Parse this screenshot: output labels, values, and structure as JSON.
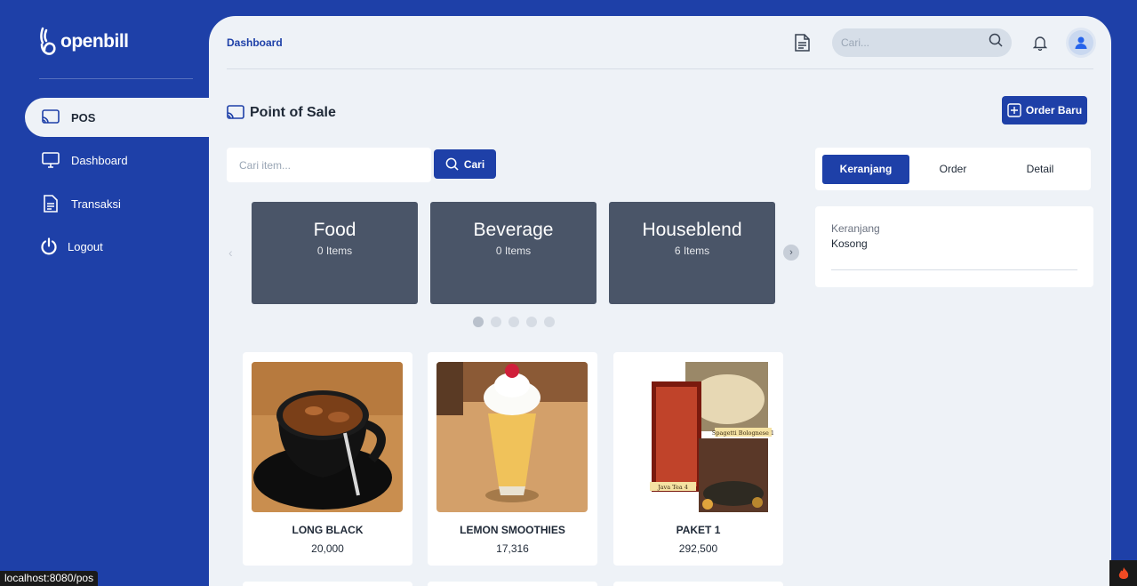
{
  "app": {
    "logo_text": "openbill"
  },
  "sidebar": {
    "items": [
      {
        "label": "POS",
        "icon": "cast-icon",
        "active": true
      },
      {
        "label": "Dashboard",
        "icon": "monitor-icon"
      },
      {
        "label": "Transaksi",
        "icon": "document-icon"
      },
      {
        "label": "Logout",
        "icon": "power-icon"
      }
    ]
  },
  "header": {
    "breadcrumb": "Dashboard",
    "search_placeholder": "Cari..."
  },
  "page": {
    "title": "Point of Sale",
    "order_button": "Order Baru",
    "item_search_placeholder": "Cari item...",
    "search_button": "Cari"
  },
  "categories": [
    {
      "name": "Food",
      "count": "0 Items"
    },
    {
      "name": "Beverage",
      "count": "0 Items"
    },
    {
      "name": "Houseblend",
      "count": "6 Items"
    }
  ],
  "products": [
    {
      "name": "LONG BLACK",
      "price": "20,000"
    },
    {
      "name": "LEMON SMOOTHIES",
      "price": "17,316"
    },
    {
      "name": "PAKET 1",
      "price": "292,500",
      "image_labels": [
        "Spagetti Bolognese 1",
        "Java Tea 4"
      ]
    }
  ],
  "cart_panel": {
    "tabs": [
      "Keranjang",
      "Order",
      "Detail"
    ],
    "label": "Keranjang",
    "empty_text": "Kosong"
  },
  "browser": {
    "status_url": "localhost:8080/pos"
  },
  "colors": {
    "primary": "#1e40a8",
    "background": "#eef2f7",
    "category_card": "#4a5568"
  }
}
